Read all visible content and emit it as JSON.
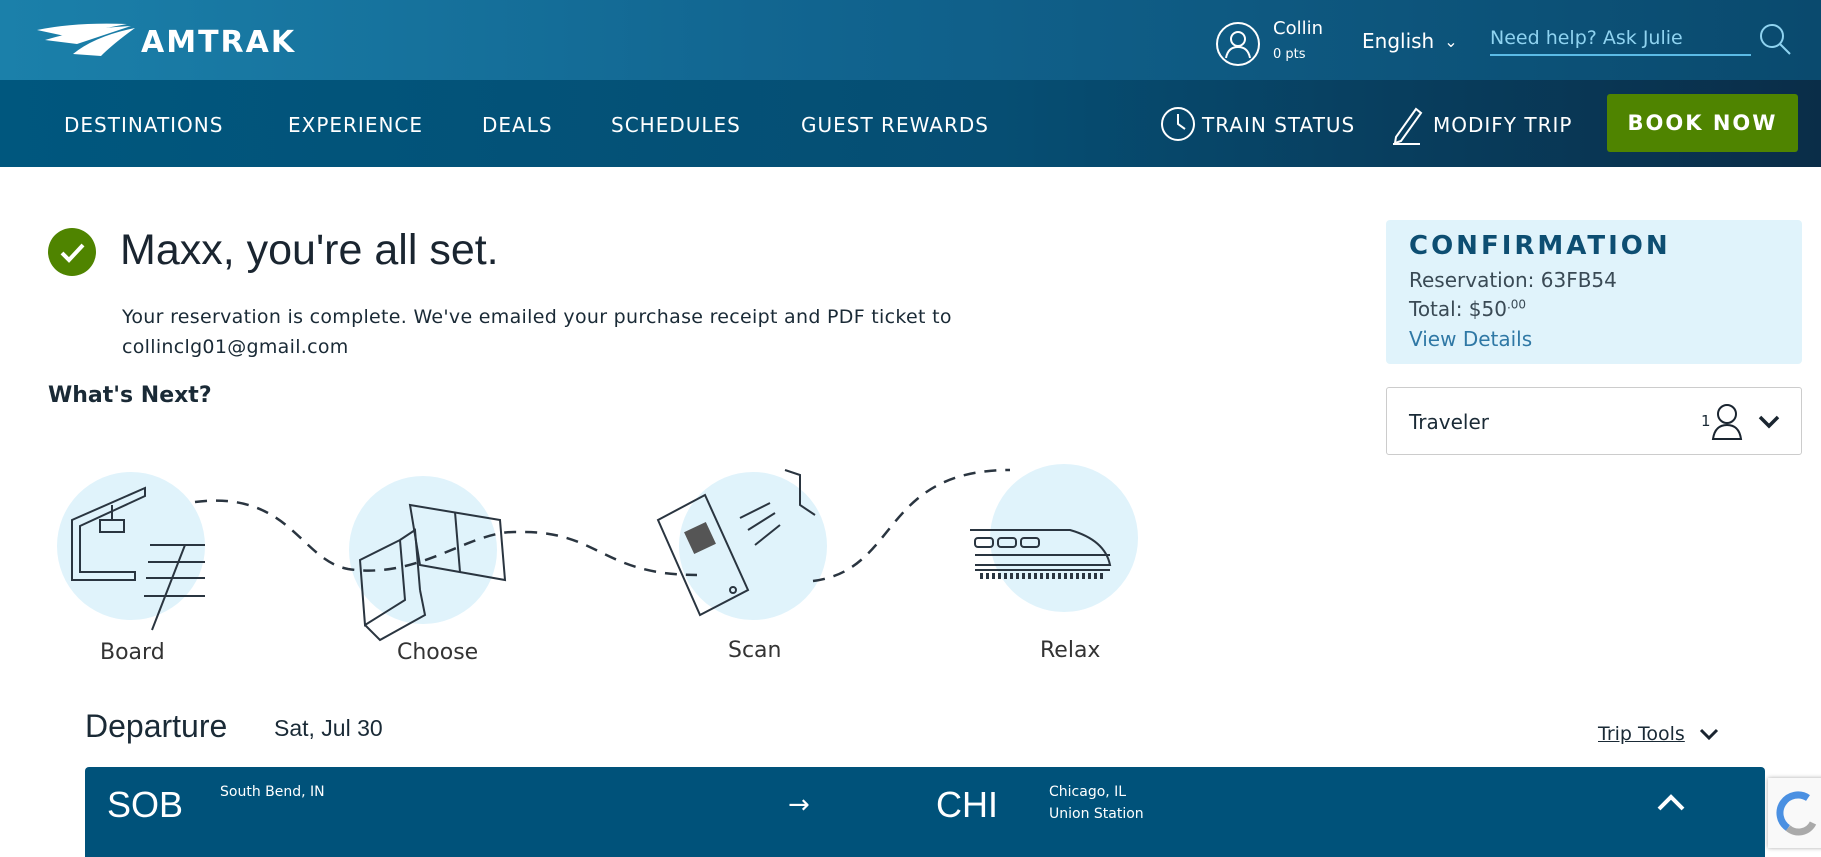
{
  "header": {
    "logo_text": "AMTRAK",
    "user": {
      "name": "Collin",
      "points": "0 pts"
    },
    "language": "English",
    "search_placeholder": "Need help? Ask Julie"
  },
  "nav": {
    "items": [
      {
        "label": "DESTINATIONS"
      },
      {
        "label": "EXPERIENCE"
      },
      {
        "label": "DEALS"
      },
      {
        "label": "SCHEDULES"
      },
      {
        "label": "GUEST REWARDS"
      }
    ],
    "train_status": "TRAIN STATUS",
    "modify_trip": "MODIFY TRIP",
    "book_now": "BOOK NOW"
  },
  "main": {
    "title": "Maxx, you're all set.",
    "message_line1": "Your reservation is complete. We've emailed your purchase receipt and PDF ticket to",
    "email": "collinclg01@gmail.com",
    "whats_next": "What's Next?",
    "steps": [
      {
        "label": "Board"
      },
      {
        "label": "Choose"
      },
      {
        "label": "Scan"
      },
      {
        "label": "Relax"
      }
    ],
    "departure_label": "Departure",
    "departure_date": "Sat, Jul 30",
    "trip_tools": "Trip Tools",
    "trip": {
      "origin_code": "SOB",
      "origin_city": "South Bend, IN",
      "dest_code": "CHI",
      "dest_city": "Chicago, IL",
      "dest_station": "Union Station"
    }
  },
  "sidebar": {
    "confirmation_title": "CONFIRMATION",
    "reservation": "Reservation: 63FB54",
    "total_label": "Total: $50",
    "total_cents": ".00",
    "view_details": "View Details",
    "traveler_label": "Traveler",
    "traveler_count": "1"
  },
  "colors": {
    "accent_green": "#4f8400",
    "brand_blue": "#00527a",
    "confirm_bg": "#e0f3fb",
    "check_green": "#4f8400"
  }
}
